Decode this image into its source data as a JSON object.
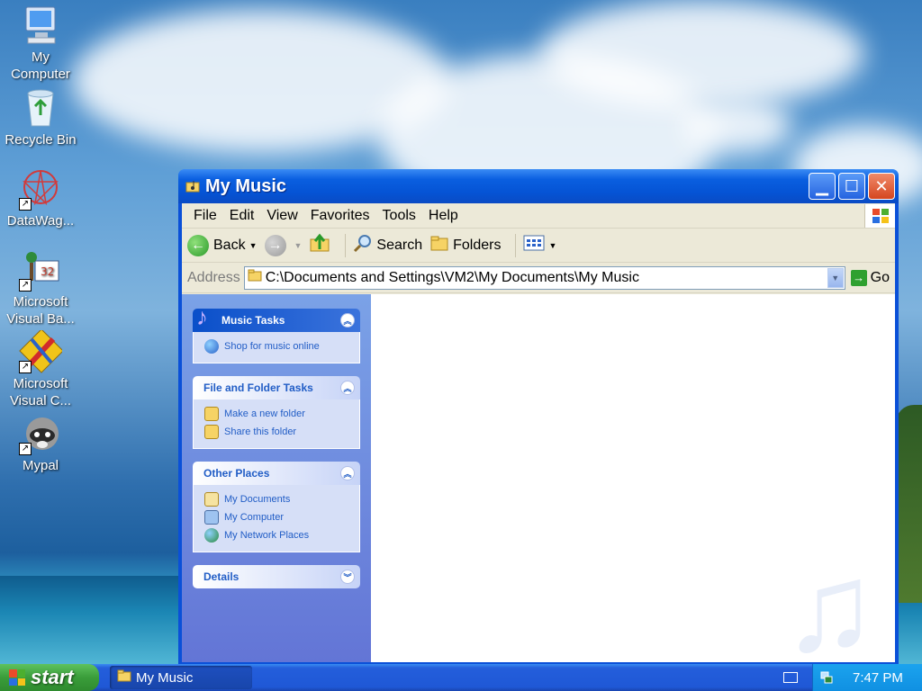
{
  "desktop": {
    "icons": [
      {
        "label": "My Computer",
        "icon": "my-computer-icon"
      },
      {
        "label": "Recycle Bin",
        "icon": "recycle-bin-icon"
      },
      {
        "label": "DataWag...",
        "icon": "datawag-icon"
      },
      {
        "label": "Microsoft Visual Ba...",
        "icon": "visual-basic-icon"
      },
      {
        "label": "Microsoft Visual C...",
        "icon": "visual-c-icon"
      },
      {
        "label": "Mypal",
        "icon": "mypal-icon"
      }
    ]
  },
  "window": {
    "title": "My Music",
    "menu": [
      "File",
      "Edit",
      "View",
      "Favorites",
      "Tools",
      "Help"
    ],
    "toolbar": {
      "back": "Back",
      "search": "Search",
      "folders": "Folders"
    },
    "address": {
      "label": "Address",
      "value": "C:\\Documents and Settings\\VM2\\My Documents\\My Music",
      "go": "Go"
    },
    "panels": {
      "music_tasks": {
        "title": "Music Tasks",
        "items": [
          "Shop for music online"
        ]
      },
      "file_folder_tasks": {
        "title": "File and Folder Tasks",
        "items": [
          "Make a new folder",
          "Share this folder"
        ]
      },
      "other_places": {
        "title": "Other Places",
        "items": [
          "My Documents",
          "My Computer",
          "My Network Places"
        ]
      },
      "details": {
        "title": "Details"
      }
    }
  },
  "taskbar": {
    "start_label": "start",
    "task_button": "My Music",
    "clock": "7:47 PM"
  },
  "colors": {
    "title_bar": "#0553d4",
    "taskpane": "#6375d6",
    "link": "#215dc6",
    "start": "#3a9d3a"
  }
}
